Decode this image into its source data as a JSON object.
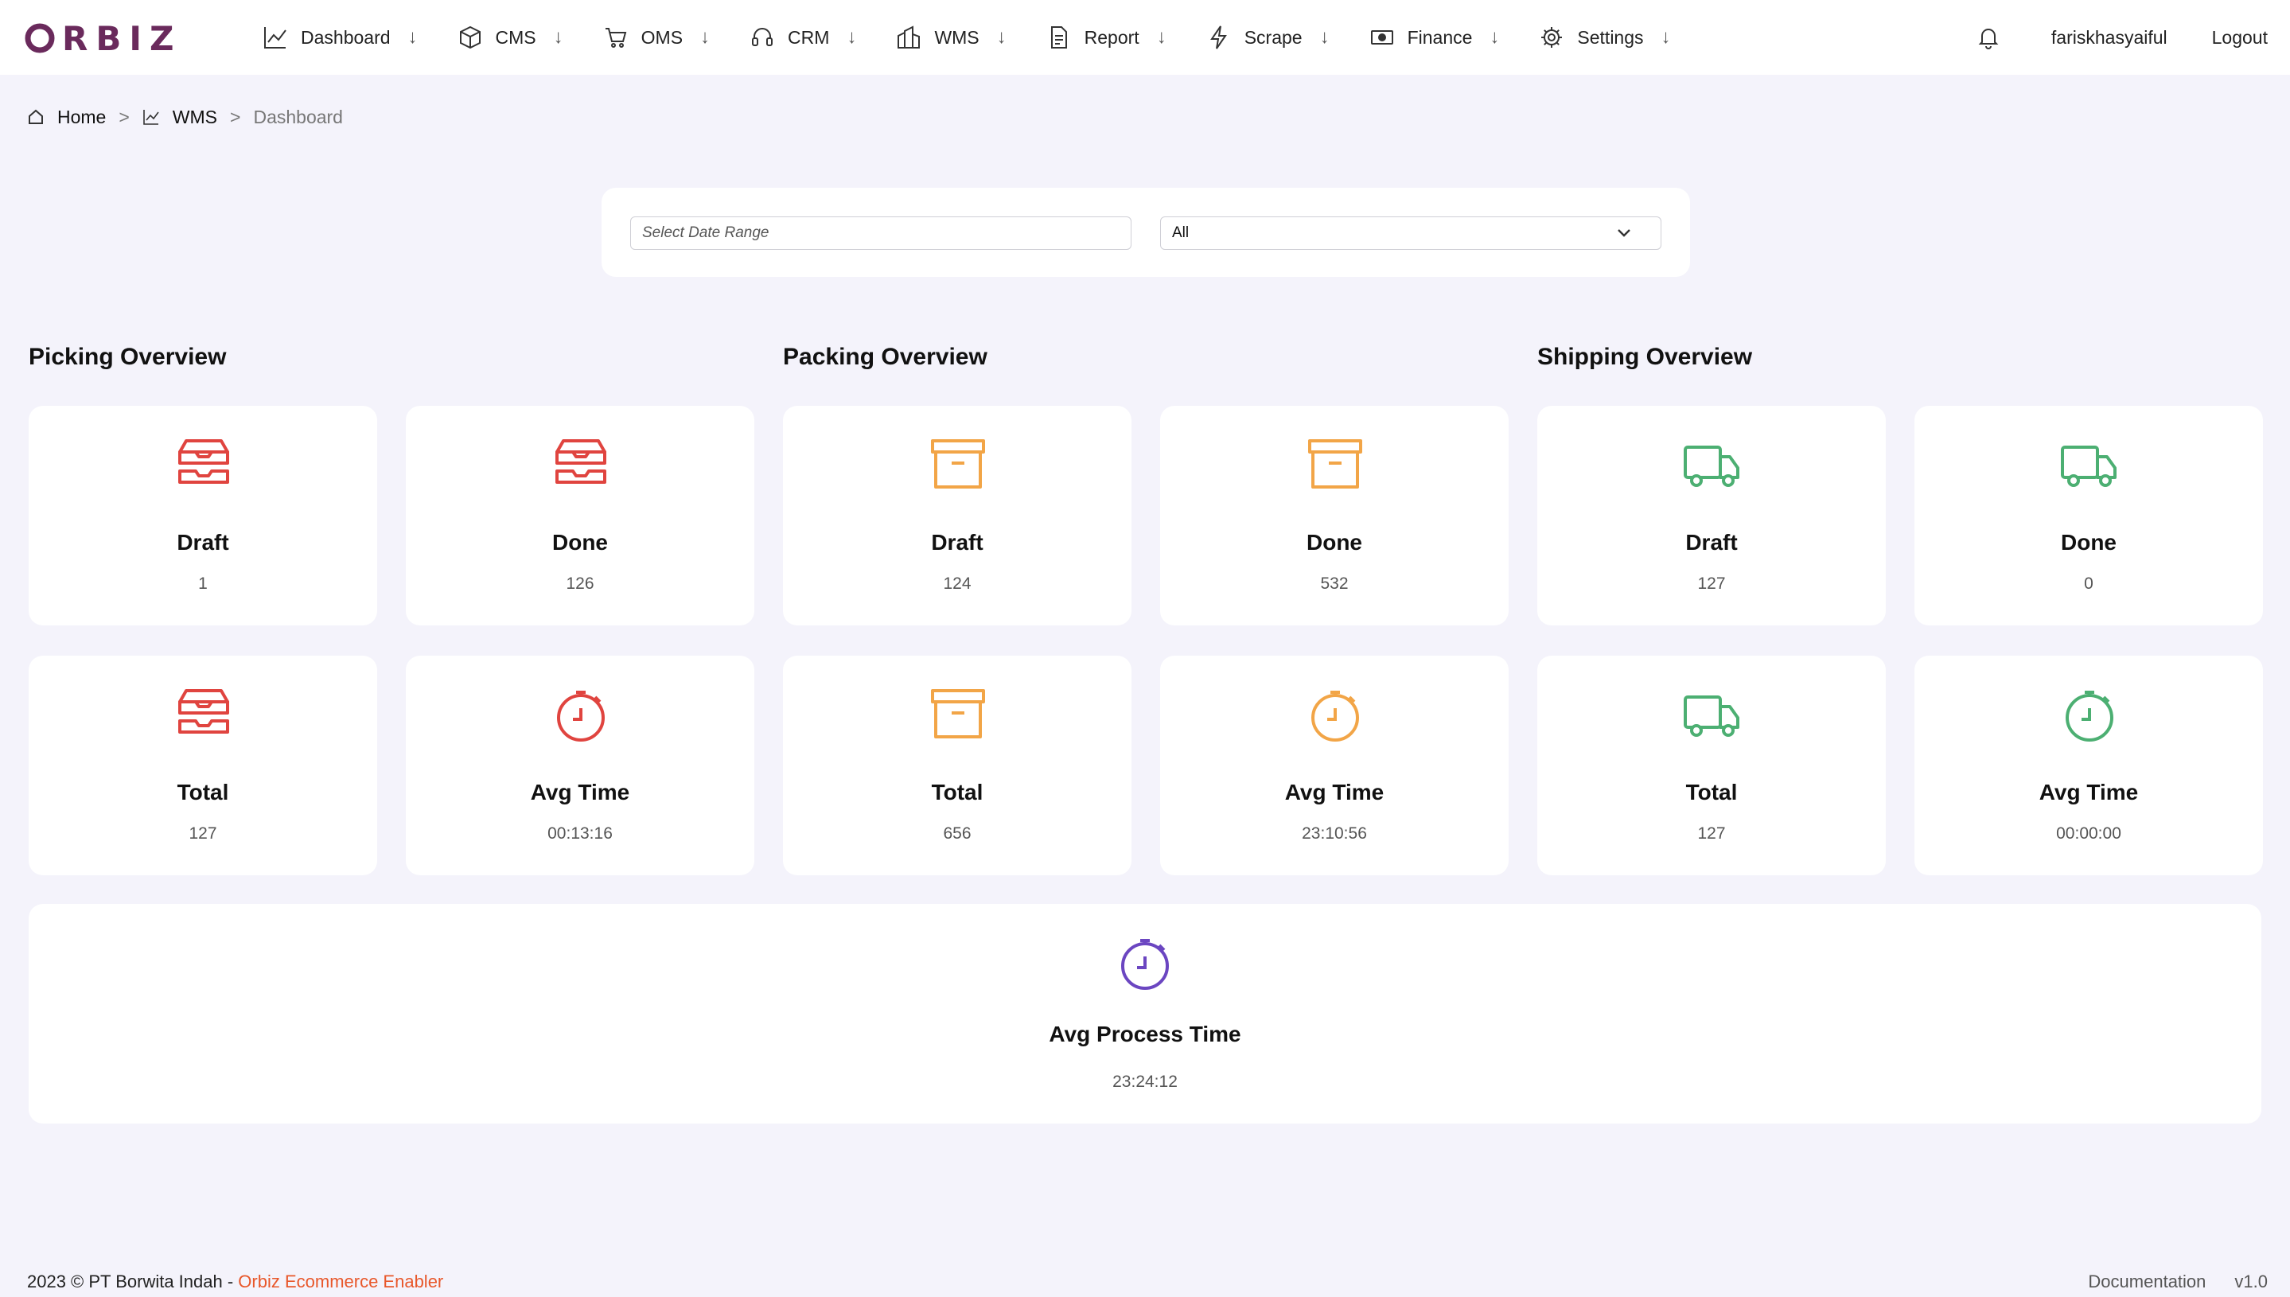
{
  "brand": {
    "logo_text": "RBIZ",
    "logo_color": "#6a2a5c"
  },
  "nav": {
    "items": [
      {
        "label": "Dashboard",
        "icon": "chart-line-icon"
      },
      {
        "label": "CMS",
        "icon": "box-icon"
      },
      {
        "label": "OMS",
        "icon": "cart-icon"
      },
      {
        "label": "CRM",
        "icon": "headset-icon"
      },
      {
        "label": "WMS",
        "icon": "warehouse-icon"
      },
      {
        "label": "Report",
        "icon": "document-icon"
      },
      {
        "label": "Scrape",
        "icon": "lightning-icon"
      },
      {
        "label": "Finance",
        "icon": "money-icon"
      },
      {
        "label": "Settings",
        "icon": "gear-icon"
      }
    ],
    "dropdown_arrow": "↓",
    "username": "fariskhasyaiful",
    "logout": "Logout"
  },
  "breadcrumb": {
    "home": "Home",
    "section": "WMS",
    "current": "Dashboard",
    "sep": ">"
  },
  "filters": {
    "date_placeholder": "Select Date Range",
    "date_value": "",
    "select_value": "All"
  },
  "sections": {
    "picking": "Picking Overview",
    "packing": "Packing Overview",
    "shipping": "Shipping Overview"
  },
  "colors": {
    "picking": "#e0443f",
    "packing": "#f2a547",
    "shipping": "#4caf72",
    "process": "#6b46c1",
    "footer_brand": "#e8572a"
  },
  "cards": {
    "picking": [
      {
        "title": "Draft",
        "value": "1",
        "icon": "inbox-tray-icon"
      },
      {
        "title": "Done",
        "value": "126",
        "icon": "inbox-tray-icon"
      },
      {
        "title": "Total",
        "value": "127",
        "icon": "inbox-tray-icon"
      },
      {
        "title": "Avg Time",
        "value": "00:13:16",
        "icon": "stopwatch-icon"
      }
    ],
    "packing": [
      {
        "title": "Draft",
        "value": "124",
        "icon": "archive-box-icon"
      },
      {
        "title": "Done",
        "value": "532",
        "icon": "archive-box-icon"
      },
      {
        "title": "Total",
        "value": "656",
        "icon": "archive-box-icon"
      },
      {
        "title": "Avg Time",
        "value": "23:10:56",
        "icon": "stopwatch-icon"
      }
    ],
    "shipping": [
      {
        "title": "Draft",
        "value": "127",
        "icon": "truck-icon"
      },
      {
        "title": "Done",
        "value": "0",
        "icon": "truck-icon"
      },
      {
        "title": "Total",
        "value": "127",
        "icon": "truck-icon"
      },
      {
        "title": "Avg Time",
        "value": "00:00:00",
        "icon": "stopwatch-icon"
      }
    ],
    "process": {
      "title": "Avg Process Time",
      "value": "23:24:12",
      "icon": "stopwatch-icon"
    }
  },
  "footer": {
    "copyright": "2023 © PT Borwita Indah - ",
    "brand": "Orbiz Ecommerce Enabler",
    "documentation": "Documentation",
    "version": "v1.0"
  }
}
